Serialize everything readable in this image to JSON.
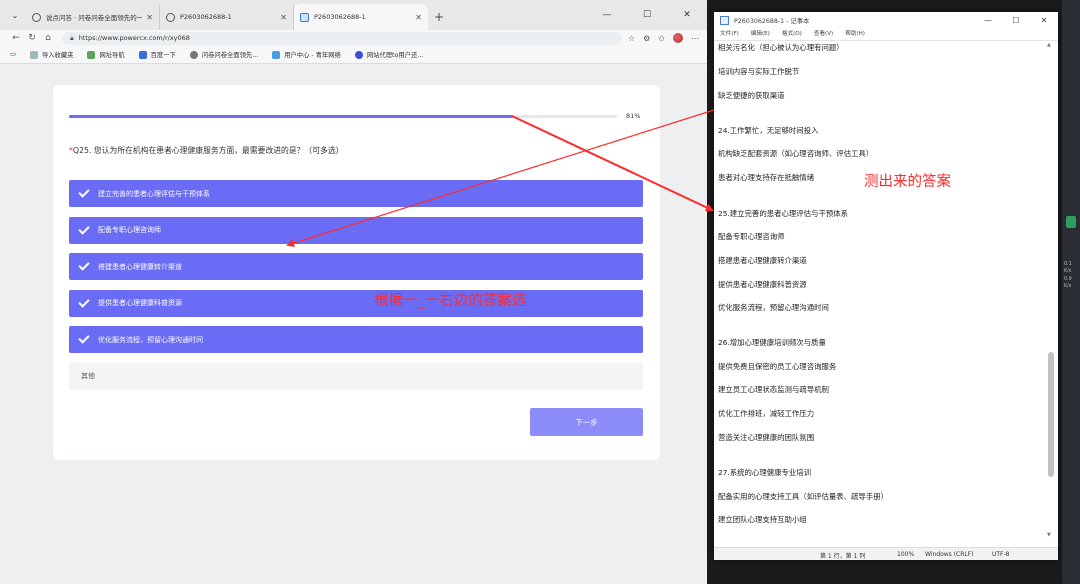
{
  "browser": {
    "tabs": [
      {
        "title": "说点问答 · 问卷问卷全面领先的一",
        "active": false
      },
      {
        "title": "P2603062688-1",
        "active": false
      },
      {
        "title": "P2603062688-1",
        "active": true
      }
    ],
    "url": "https://www.powercx.com/r/xy068",
    "bookmarks": [
      "导入收藏夹",
      "网址导航",
      "百度一下",
      "问卷问卷全面领先...",
      "用户中心 - 青年网络",
      "网站代理to用户还..."
    ]
  },
  "survey": {
    "progress": 0.81,
    "progress_label": "81%",
    "question_marker": "*",
    "question": "Q25. 您认为所在机构在患者心理健康服务方面，最需要改进的是？（可多选）",
    "options": [
      {
        "label": "建立完善的患者心理评估与干预体系",
        "checked": true
      },
      {
        "label": "配备专职心理咨询师",
        "checked": true
      },
      {
        "label": "搭建患者心理健康转介渠道",
        "checked": true
      },
      {
        "label": "提供患者心理健康科普资源",
        "checked": true
      },
      {
        "label": "优化服务流程，预留心理沟通时间",
        "checked": true
      },
      {
        "label": "其他",
        "checked": false
      }
    ],
    "next_label": "下一步",
    "accent_color": "#6a6cf6"
  },
  "notepad": {
    "title": "P2603062688-1 - 记事本",
    "menu": [
      "文件(F)",
      "编辑(E)",
      "格式(O)",
      "查看(V)",
      "帮助(H)"
    ],
    "lines": [
      "相关污名化（担心被认为心理有问题）",
      "培训内容与实际工作脱节",
      "缺乏便捷的获取渠道",
      "24.工作繁忙，无足够时间投入",
      "机构缺乏配套资源（如心理咨询师、评估工具）",
      "患者对心理支持存在抵触情绪",
      "25.建立完善的患者心理评估与干预体系",
      "配备专职心理咨询师",
      "搭建患者心理健康转介渠道",
      "提供患者心理健康科普资源",
      "优化服务流程，预留心理沟通时间",
      "26.增加心理健康培训频次与质量",
      "提供免费且保密的员工心理咨询服务",
      "建立员工心理状态监测与疏导机制",
      "优化工作排班，减轻工作压力",
      "营造关注心理健康的团队氛围",
      "27.系统的心理健康专业培训",
      "配备实用的心理支持工具（如评估量表、疏导手册）",
      "建立团队心理支持互助小组"
    ],
    "status": {
      "position": "第 1 行，第 1 列",
      "zoom": "100%",
      "line_ending": "Windows (CRLF)",
      "encoding": "UTF-8"
    }
  },
  "annotations": {
    "right_label": "测出来的答案",
    "left_label": "根据一_一右边的答案选",
    "color": "#ff2a2a"
  },
  "edge": {
    "texts": [
      "0.1",
      "K/s",
      "0.9",
      "K/s"
    ]
  }
}
